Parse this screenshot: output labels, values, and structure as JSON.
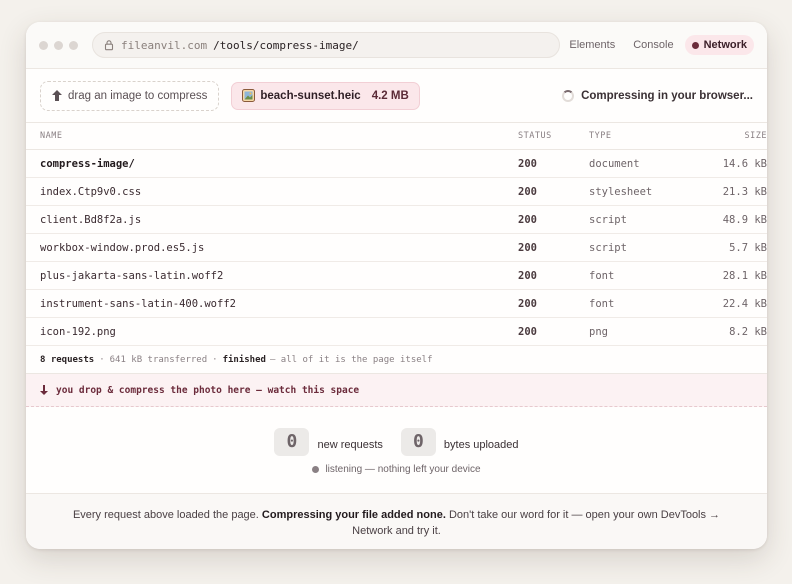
{
  "url": {
    "host": "fileanvil.com",
    "path": "/tools/compress-image/"
  },
  "devtools_tabs": [
    {
      "label": "Elements"
    },
    {
      "label": "Console"
    },
    {
      "label": "Network"
    }
  ],
  "actions": {
    "drop_label": "drag an image to compress",
    "file_name": "beach-sunset.heic",
    "file_size": "4.2 MB",
    "status_text": "Compressing in your browser..."
  },
  "table": {
    "headers": {
      "name": "NAME",
      "status": "STATUS",
      "type": "TYPE",
      "size": "SIZE"
    },
    "rows": [
      {
        "name": "compress-image/",
        "status": "200",
        "type": "document",
        "size": "14.6 kB"
      },
      {
        "name": "index.Ctp9v0.css",
        "status": "200",
        "type": "stylesheet",
        "size": "21.3 kB"
      },
      {
        "name": "client.Bd8f2a.js",
        "status": "200",
        "type": "script",
        "size": "48.9 kB"
      },
      {
        "name": "workbox-window.prod.es5.js",
        "status": "200",
        "type": "script",
        "size": "5.7 kB"
      },
      {
        "name": "plus-jakarta-sans-latin.woff2",
        "status": "200",
        "type": "font",
        "size": "28.1 kB"
      },
      {
        "name": "instrument-sans-latin-400.woff2",
        "status": "200",
        "type": "font",
        "size": "22.4 kB"
      },
      {
        "name": "icon-192.png",
        "status": "200",
        "type": "png",
        "size": "8.2 kB"
      }
    ]
  },
  "summary": {
    "requests": "8 requests",
    "transferred": "641 kB transferred",
    "finished": "finished",
    "note": "— all of it is the page itself"
  },
  "banner": {
    "text": "you drop & compress the photo here — watch this space"
  },
  "counters": {
    "new_requests_value": "0",
    "new_requests_label": "new requests",
    "bytes_uploaded_value": "0",
    "bytes_uploaded_label": "bytes uploaded",
    "listening_text": "listening — nothing left your device"
  },
  "footer": {
    "part1": "Every request above loaded the page. ",
    "bold": "Compressing your file added none.",
    "part2": " Don't take our word for it — open your own DevTools → Network and try it."
  },
  "colors": {
    "accent": "#6b2b3b",
    "chip_bg": "#fbe7ea",
    "banner_bg": "#fcf2f3"
  }
}
